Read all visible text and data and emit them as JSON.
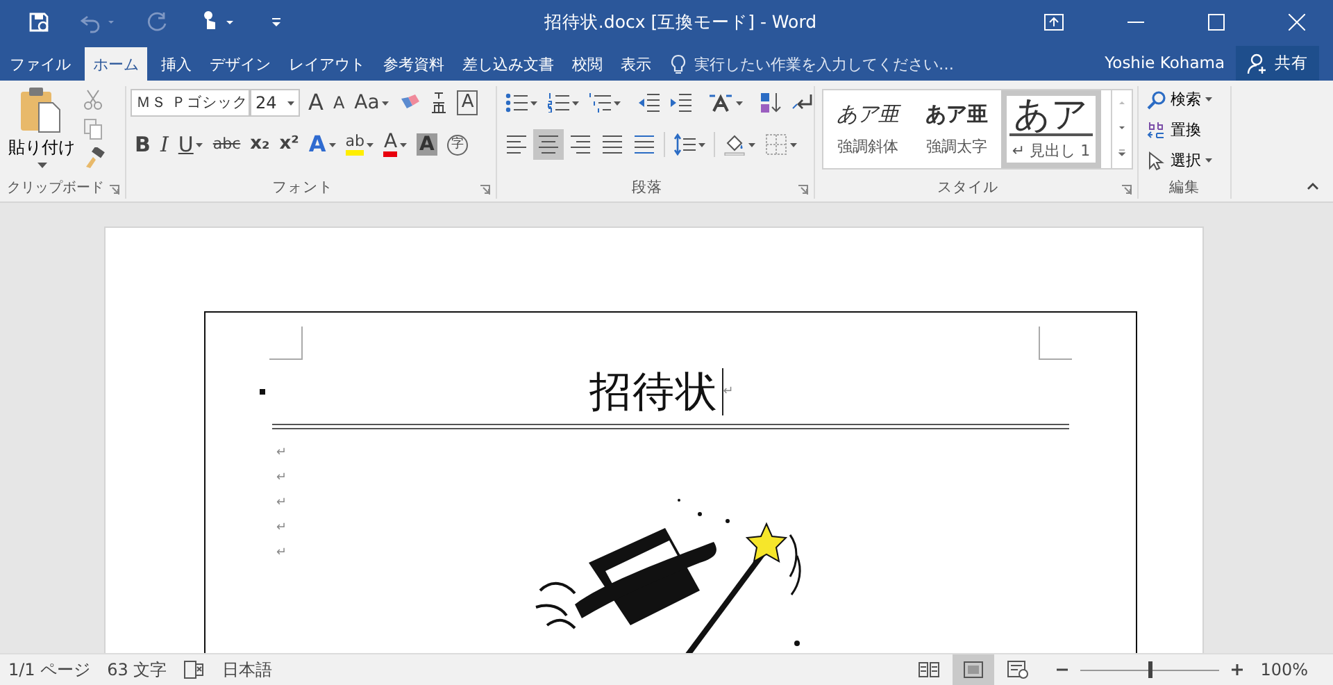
{
  "window": {
    "title": "招待状.docx [互換モード] - Word"
  },
  "tabs": [
    {
      "label": "ファイル",
      "selected": false
    },
    {
      "label": "ホーム",
      "selected": true
    },
    {
      "label": "挿入",
      "selected": false
    },
    {
      "label": "デザイン",
      "selected": false
    },
    {
      "label": "レイアウト",
      "selected": false
    },
    {
      "label": "参考資料",
      "selected": false
    },
    {
      "label": "差し込み文書",
      "selected": false
    },
    {
      "label": "校閲",
      "selected": false
    },
    {
      "label": "表示",
      "selected": false
    }
  ],
  "tell_me": {
    "placeholder": "実行したい作業を入力してください…"
  },
  "user": "Yoshie Kohama",
  "share": "共有",
  "ribbon": {
    "clipboard": {
      "paste": "貼り付け",
      "label": "クリップボード"
    },
    "font": {
      "name": "ＭＳ Ｐゴシック",
      "size": "24",
      "label": "フォント",
      "row1": [
        {
          "kind": "grow",
          "glyph": "A"
        },
        {
          "kind": "shrink",
          "glyph": "A"
        },
        {
          "kind": "case",
          "glyph": "Aa",
          "dropdown": true
        },
        {
          "kind": "clear"
        },
        {
          "kind": "phonetic"
        },
        {
          "kind": "border",
          "glyph": "A"
        }
      ],
      "row2": [
        {
          "kind": "bold",
          "glyph": "B"
        },
        {
          "kind": "italic",
          "glyph": "I"
        },
        {
          "kind": "underline",
          "glyph": "U",
          "dropdown": true
        },
        {
          "kind": "strike",
          "glyph": "abc"
        },
        {
          "kind": "sub",
          "glyph": "x₂"
        },
        {
          "kind": "sup",
          "glyph": "x²"
        },
        {
          "kind": "effects",
          "glyph": "A",
          "dropdown": true
        },
        {
          "kind": "highlight",
          "glyph": "ab",
          "dropdown": true
        },
        {
          "kind": "color",
          "glyph": "A",
          "dropdown": true
        },
        {
          "kind": "shade",
          "glyph": "A"
        },
        {
          "kind": "enclose",
          "glyph": "字"
        }
      ]
    },
    "paragraph": {
      "label": "段落",
      "alignments": [
        {
          "kind": "left",
          "selected": false
        },
        {
          "kind": "center",
          "selected": true
        },
        {
          "kind": "right",
          "selected": false
        },
        {
          "kind": "justify",
          "selected": false
        },
        {
          "kind": "distributed",
          "selected": false
        }
      ]
    },
    "styles": {
      "label": "スタイル",
      "items": [
        {
          "kind": "italic",
          "preview": "あア亜",
          "name": "強調斜体",
          "selected": false
        },
        {
          "kind": "bold",
          "preview": "あア亜",
          "name": "強調太字",
          "selected": false
        },
        {
          "kind": "heading",
          "preview": "あア",
          "name": "↵ 見出し 1",
          "selected": true
        }
      ]
    },
    "editing": {
      "label": "編集",
      "items": [
        {
          "kind": "find",
          "label": "検索",
          "dropdown": true
        },
        {
          "kind": "replace",
          "label": "置換",
          "dropdown": false
        },
        {
          "kind": "select",
          "label": "選択",
          "dropdown": true
        }
      ]
    }
  },
  "document": {
    "heading": "招待状",
    "heading_mark": "↵",
    "marks": [
      "↵",
      "↵",
      "↵",
      "↵",
      "↵"
    ]
  },
  "status_bar": {
    "page": "1/1 ページ",
    "words": "63 文字",
    "language": "日本語",
    "views": [
      {
        "kind": "read",
        "selected": false
      },
      {
        "kind": "print",
        "selected": true
      },
      {
        "kind": "web",
        "selected": false
      }
    ],
    "zoom": {
      "level": 0.5,
      "text": "100%"
    }
  }
}
